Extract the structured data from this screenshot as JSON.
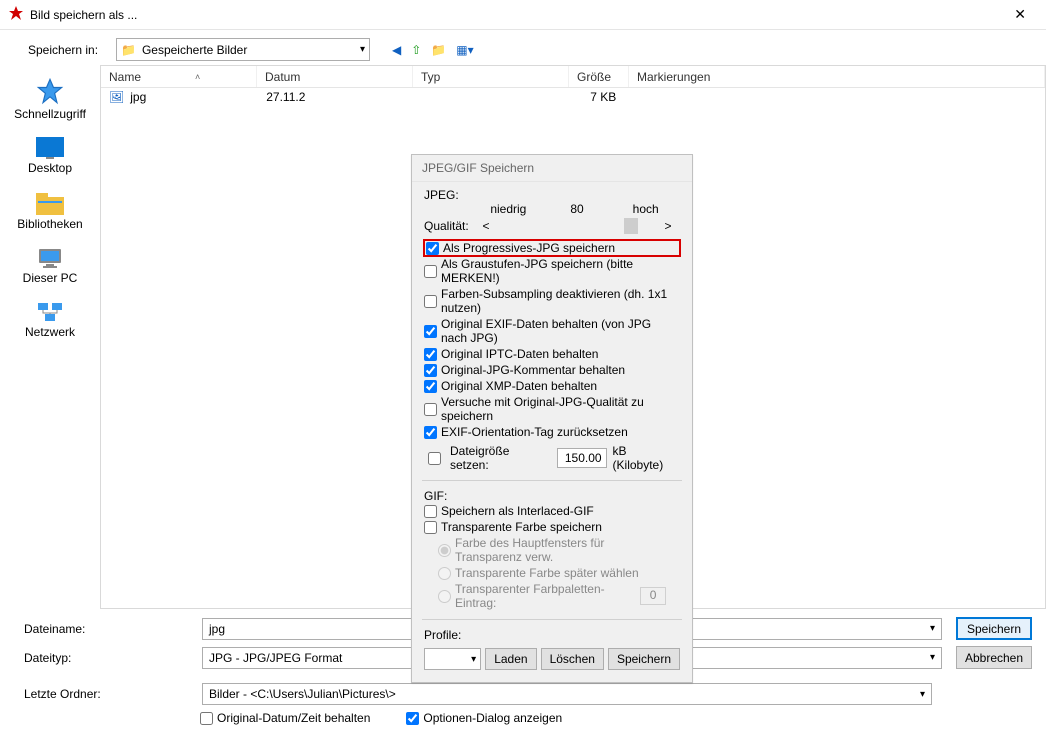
{
  "window": {
    "title": "Bild speichern als ..."
  },
  "toolbar": {
    "save_in_label": "Speichern in:",
    "save_in_value": "Gespeicherte Bilder"
  },
  "sidebar": {
    "places": [
      {
        "label": "Schnellzugriff"
      },
      {
        "label": "Desktop"
      },
      {
        "label": "Bibliotheken"
      },
      {
        "label": "Dieser PC"
      },
      {
        "label": "Netzwerk"
      }
    ]
  },
  "columns": {
    "name": "Name",
    "date": "Datum",
    "type": "Typ",
    "size": "Größe",
    "mark": "Markierungen"
  },
  "file": {
    "name": "jpg",
    "date": "27.11.2",
    "size_suffix": "7 KB"
  },
  "bottom": {
    "filename_label": "Dateiname:",
    "filename_value": "jpg",
    "filetype_label": "Dateityp:",
    "filetype_value": "JPG - JPG/JPEG Format",
    "lastfolder_label": "Letzte Ordner:",
    "lastfolder_value": "Bilder  -  <C:\\Users\\Julian\\Pictures\\>",
    "save_btn": "Speichern",
    "cancel_btn": "Abbrechen",
    "keep_original_date": "Original-Datum/Zeit behalten",
    "show_options_dialog": "Optionen-Dialog anzeigen"
  },
  "popup": {
    "title": "JPEG/GIF Speichern",
    "jpeg_label": "JPEG:",
    "quality_low": "niedrig",
    "quality_value": "80",
    "quality_high": "hoch",
    "quality_label": "Qualität:",
    "opts": [
      {
        "label": "Als Progressives-JPG speichern",
        "checked": true,
        "highlight": true
      },
      {
        "label": "Als Graustufen-JPG speichern (bitte MERKEN!)",
        "checked": false
      },
      {
        "label": "Farben-Subsampling deaktivieren (dh. 1x1 nutzen)",
        "checked": false
      },
      {
        "label": "Original EXIF-Daten behalten (von JPG nach JPG)",
        "checked": true
      },
      {
        "label": "Original IPTC-Daten behalten",
        "checked": true
      },
      {
        "label": "Original-JPG-Kommentar behalten",
        "checked": true
      },
      {
        "label": "Original XMP-Daten behalten",
        "checked": true
      },
      {
        "label": "Versuche mit Original-JPG-Qualität zu speichern",
        "checked": false
      },
      {
        "label": "EXIF-Orientation-Tag zurücksetzen",
        "checked": true
      }
    ],
    "filesize_label": "Dateigröße setzen:",
    "filesize_value": "150.00",
    "filesize_unit": "kB  (Kilobyte)",
    "gif_label": "GIF:",
    "gif_interlaced": "Speichern als Interlaced-GIF",
    "gif_transparent": "Transparente Farbe speichern",
    "radio1": "Farbe des Hauptfensters für Transparenz verw.",
    "radio2": "Transparente Farbe später wählen",
    "radio3": "Transparenter Farbpaletten-Eintrag:",
    "radio3_val": "0",
    "profile_label": "Profile:",
    "load_btn": "Laden",
    "delete_btn": "Löschen",
    "save_profile_btn": "Speichern"
  }
}
